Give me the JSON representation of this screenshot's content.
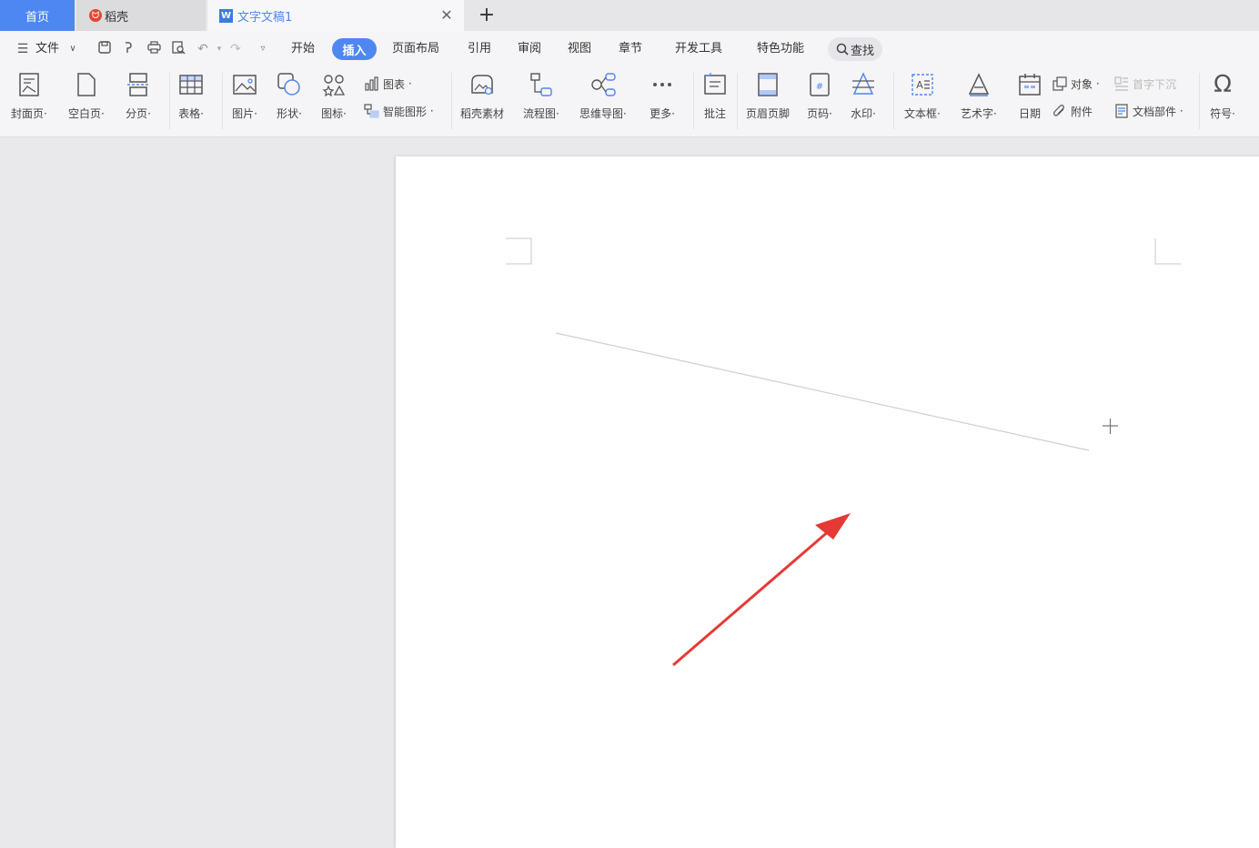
{
  "tabs": {
    "home": "首页",
    "daoke": "稻壳",
    "document": "文字文稿1",
    "new_tab": "+"
  },
  "menubar": {
    "file_menu": "文件",
    "tabs": [
      "开始",
      "插入",
      "页面布局",
      "引用",
      "审阅",
      "视图",
      "章节",
      "开发工具",
      "特色功能"
    ],
    "active_tab": "插入",
    "search": "查找"
  },
  "ribbon": {
    "cover_page": "封面页",
    "blank_page": "空白页",
    "page_break": "分页",
    "table": "表格",
    "picture": "图片",
    "shape": "形状",
    "icon": "图标",
    "chart": "图表",
    "smart_art": "智能图形",
    "daoke_material": "稻壳素材",
    "flowchart": "流程图",
    "mind_map": "思维导图",
    "more": "更多",
    "comment": "批注",
    "header_footer": "页眉页脚",
    "page_number": "页码",
    "watermark": "水印",
    "text_box": "文本框",
    "word_art": "艺术字",
    "date": "日期",
    "object": "对象",
    "drop_cap": "首字下沉",
    "attachment": "附件",
    "doc_parts": "文档部件",
    "symbol": "符号"
  },
  "colors": {
    "accent": "#4f87f2",
    "arrow": "#e53935",
    "line": "#cfcfcf"
  }
}
